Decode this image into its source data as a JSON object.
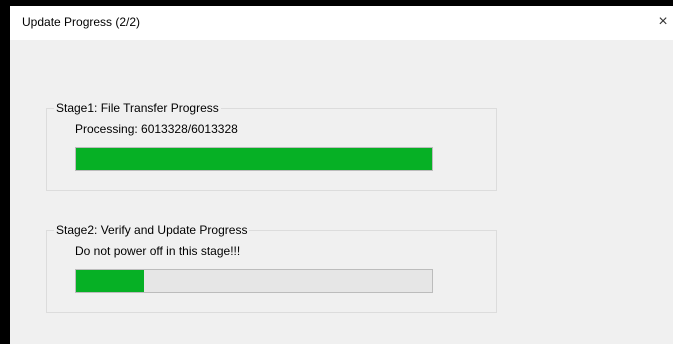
{
  "window": {
    "title": "Update Progress (2/2)",
    "close_glyph": "×"
  },
  "stage1": {
    "label": "Stage1: File Transfer Progress",
    "status": "Processing: 6013328/6013328",
    "progress_percent": 100
  },
  "stage2": {
    "label": "Stage2: Verify and Update Progress",
    "status": "Do not power off in this stage!!!",
    "progress_percent": 19
  },
  "colors": {
    "progress_fill": "#06b025",
    "progress_track": "#e6e6e6"
  }
}
